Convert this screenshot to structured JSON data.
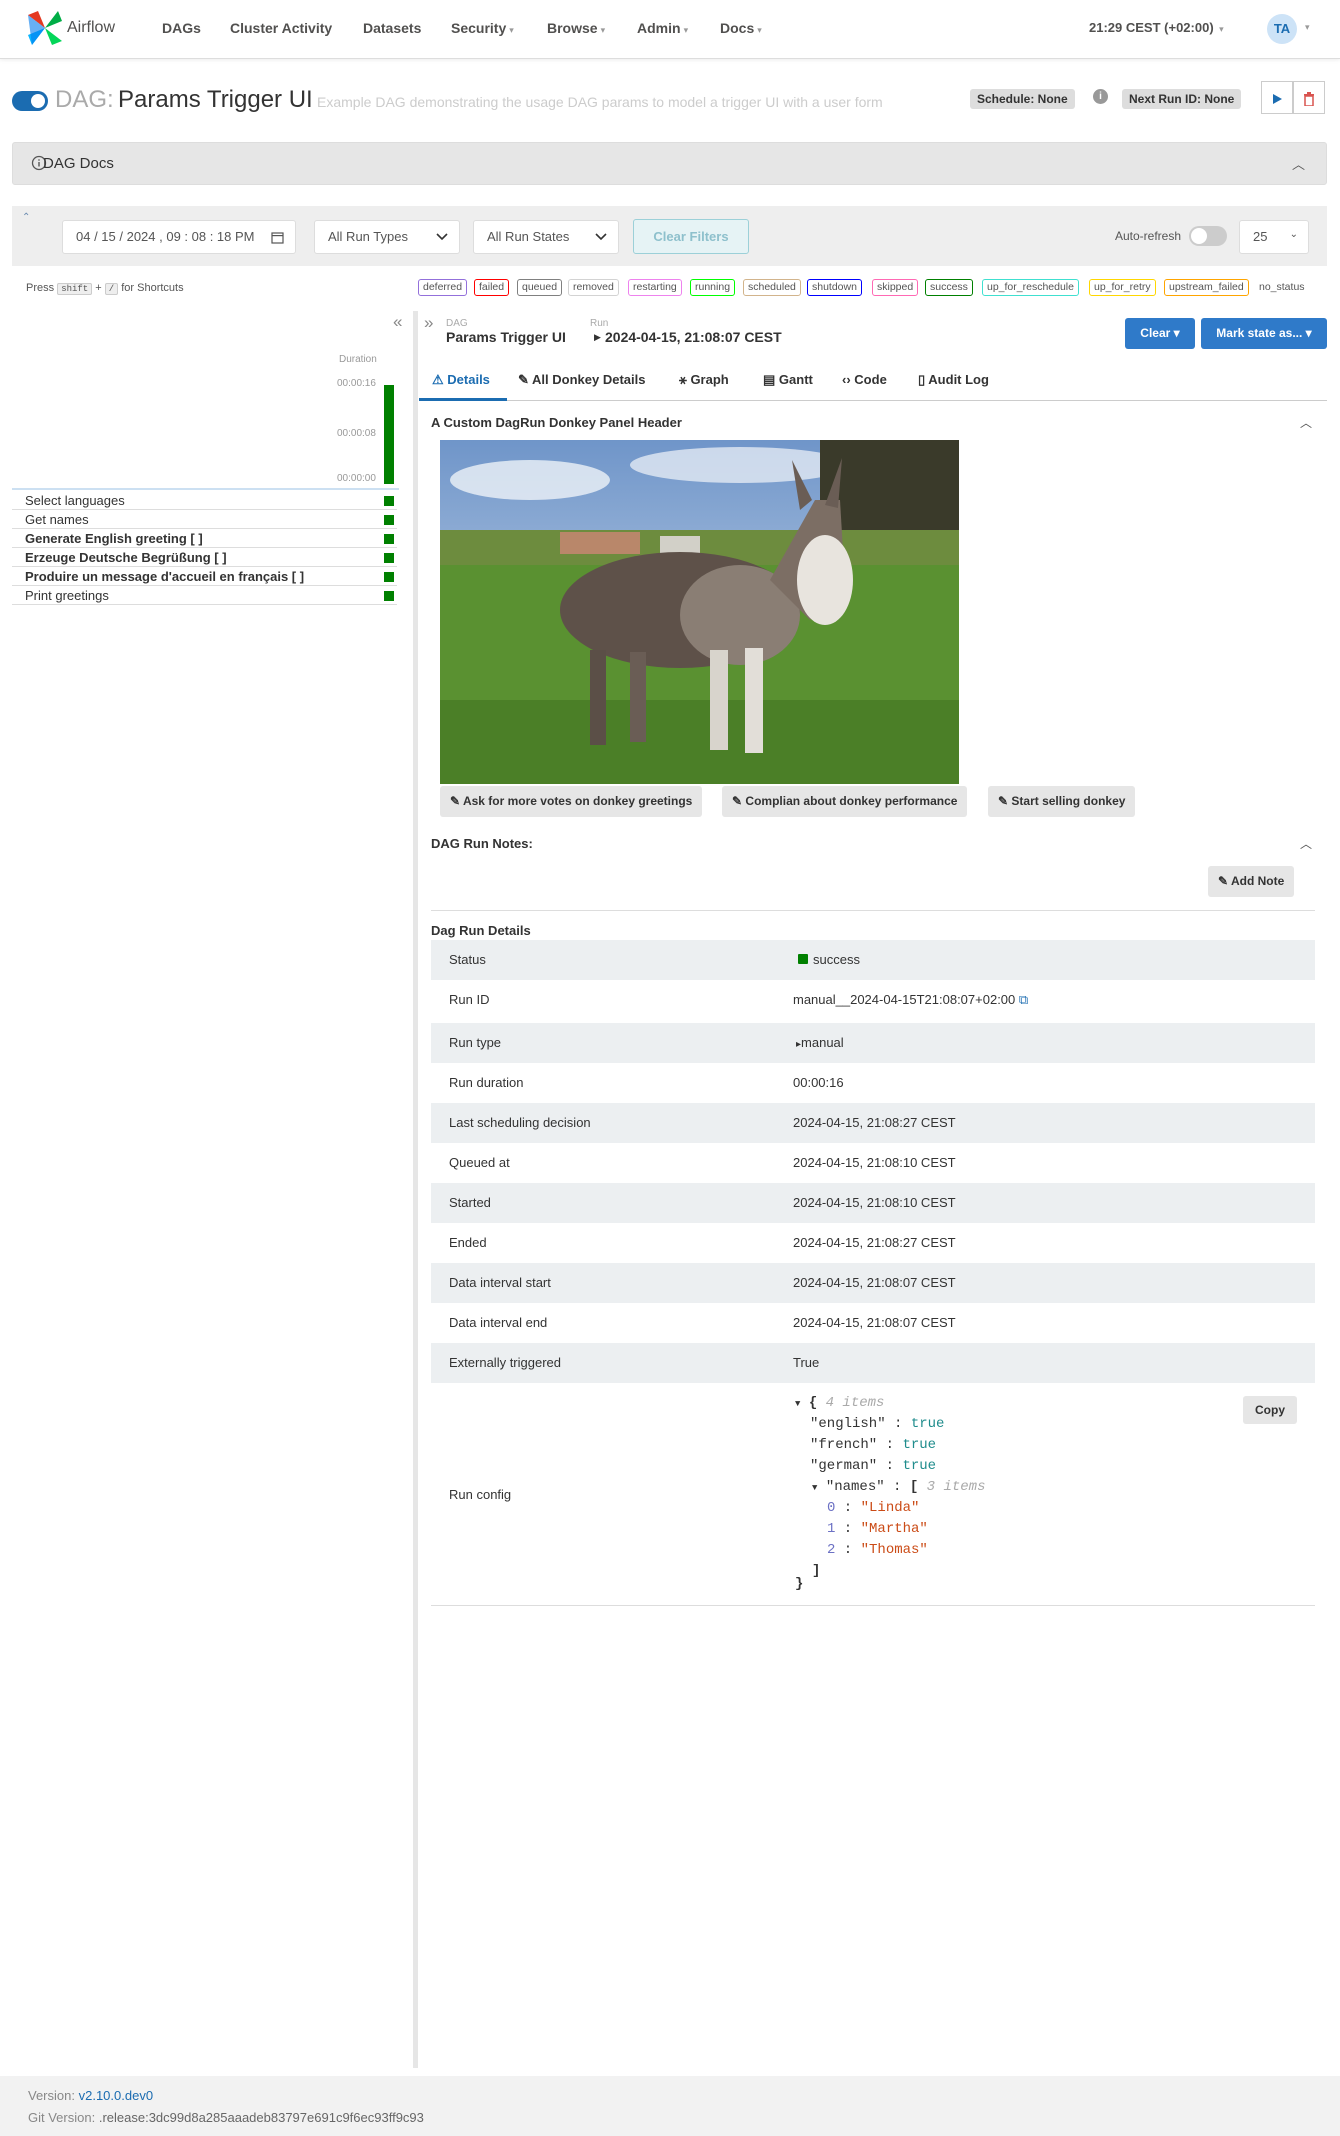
{
  "navbar": {
    "brand": "Airflow",
    "items": [
      "DAGs",
      "Cluster Activity",
      "Datasets",
      "Security",
      "Browse",
      "Admin",
      "Docs"
    ],
    "clock": "21:29 CEST (+02:00)",
    "avatar": "TA"
  },
  "dag": {
    "prefix": "DAG:",
    "name": "Params Trigger UI",
    "description": "Example DAG demonstrating the usage DAG params to model a trigger UI with a user form",
    "schedule": "Schedule: None",
    "next_run": "Next Run ID: None"
  },
  "docs": {
    "label": "DAG Docs"
  },
  "filters": {
    "date": "04 / 15 / 2024 ,  09 : 08 : 18   PM",
    "run_types": "All Run Types",
    "run_states": "All Run States",
    "clear": "Clear Filters",
    "auto_refresh": "Auto-refresh",
    "count": "25"
  },
  "shortcuts": {
    "press": "Press",
    "key1": "shift",
    "plus": "+",
    "key2": "/",
    "suffix": "for Shortcuts"
  },
  "legend": [
    {
      "label": "deferred",
      "color": "#9370db"
    },
    {
      "label": "failed",
      "color": "#ff0000"
    },
    {
      "label": "queued",
      "color": "#808080"
    },
    {
      "label": "removed",
      "color": "#d3d3d3"
    },
    {
      "label": "restarting",
      "color": "#ee82ee"
    },
    {
      "label": "running",
      "color": "#00ff00"
    },
    {
      "label": "scheduled",
      "color": "#d2b48c"
    },
    {
      "label": "shutdown",
      "color": "#0000ff"
    },
    {
      "label": "skipped",
      "color": "#ff69b4"
    },
    {
      "label": "success",
      "color": "#008000"
    },
    {
      "label": "up_for_reschedule",
      "color": "#40e0d0"
    },
    {
      "label": "up_for_retry",
      "color": "#ffd700"
    },
    {
      "label": "upstream_failed",
      "color": "#ffa500"
    },
    {
      "label": "no_status",
      "color": "#ffffff"
    }
  ],
  "grid": {
    "duration_label": "Duration",
    "ticks": [
      "00:00:16",
      "00:00:08",
      "00:00:00"
    ],
    "tasks": [
      "Select languages",
      "Get names",
      "Generate English greeting [ ]",
      "Erzeuge Deutsche Begrüßung [ ]",
      "Produire un message d'accueil en français [ ]",
      "Print greetings"
    ],
    "task_status_color": "#008000"
  },
  "breadcrumb": {
    "dag_label": "DAG",
    "dag_value": "Params Trigger UI",
    "run_label": "Run",
    "run_value": "2024-04-15, 21:08:07 CEST"
  },
  "actions": {
    "clear": "Clear",
    "mark_state": "Mark state as..."
  },
  "tabs": [
    "Details",
    "All Donkey Details",
    "Graph",
    "Gantt",
    "Code",
    "Audit Log"
  ],
  "panel": {
    "header": "A Custom DagRun Donkey Panel Header",
    "buttons": [
      "Ask for more votes on donkey greetings",
      "Complian about donkey performance",
      "Start selling donkey"
    ]
  },
  "notes": {
    "title": "DAG Run Notes:",
    "add": "Add Note"
  },
  "details": {
    "title": "Dag Run Details",
    "rows": [
      {
        "key": "Status",
        "value": "success"
      },
      {
        "key": "Run ID",
        "value": "manual__2024-04-15T21:08:07+02:00"
      },
      {
        "key": "Run type",
        "value": "manual"
      },
      {
        "key": "Run duration",
        "value": "00:00:16"
      },
      {
        "key": "Last scheduling decision",
        "value": "2024-04-15, 21:08:27 CEST"
      },
      {
        "key": "Queued at",
        "value": "2024-04-15, 21:08:10 CEST"
      },
      {
        "key": "Started",
        "value": "2024-04-15, 21:08:10 CEST"
      },
      {
        "key": "Ended",
        "value": "2024-04-15, 21:08:27 CEST"
      },
      {
        "key": "Data interval start",
        "value": "2024-04-15, 21:08:07 CEST"
      },
      {
        "key": "Data interval end",
        "value": "2024-04-15, 21:08:07 CEST"
      },
      {
        "key": "Externally triggered",
        "value": "True"
      }
    ],
    "run_config_label": "Run config",
    "copy": "Copy",
    "config": {
      "items_note": "4 items",
      "english": "true",
      "french": "true",
      "german": "true",
      "names_note": "3 items",
      "names": [
        "\"Linda\"",
        "\"Martha\"",
        "\"Thomas\""
      ]
    }
  },
  "footer": {
    "version_label": "Version:",
    "version": "v2.10.0.dev0",
    "git_label": "Git Version:",
    "git": ".release:3dc99d8a285aaadeb83797e691c9f6ec93ff9c93"
  }
}
